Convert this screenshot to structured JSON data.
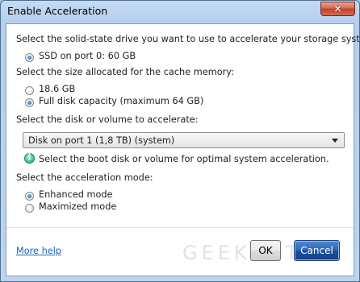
{
  "window": {
    "title": "Enable Acceleration",
    "close_glyph": "✕"
  },
  "ssd_section": {
    "prompt": "Select the solid-state drive you want to use to accelerate your storage system:",
    "options": [
      {
        "label": "SSD on port 0: 60 GB",
        "checked": true
      }
    ]
  },
  "cache_section": {
    "prompt": "Select the size allocated for the cache memory:",
    "options": [
      {
        "label": "18.6 GB",
        "checked": false
      },
      {
        "label": "Full disk capacity (maximum 64 GB)",
        "checked": true
      }
    ]
  },
  "volume_section": {
    "prompt": "Select the disk or volume to accelerate:",
    "selected_value": "Disk on port 1 (1,8 TB) (system)",
    "hint": "Select the boot disk or volume for optimal system acceleration."
  },
  "mode_section": {
    "prompt": "Select the acceleration mode:",
    "options": [
      {
        "label": "Enhanced mode",
        "checked": true
      },
      {
        "label": "Maximized mode",
        "checked": false
      }
    ]
  },
  "footer": {
    "help_link": "More help",
    "ok_label": "OK",
    "cancel_label": "Cancel"
  },
  "watermark_text": "GEEKNETIC",
  "colors": {
    "link": "#1a66b8",
    "default_button": "#2b66b6",
    "frame": "#b5cfee"
  }
}
